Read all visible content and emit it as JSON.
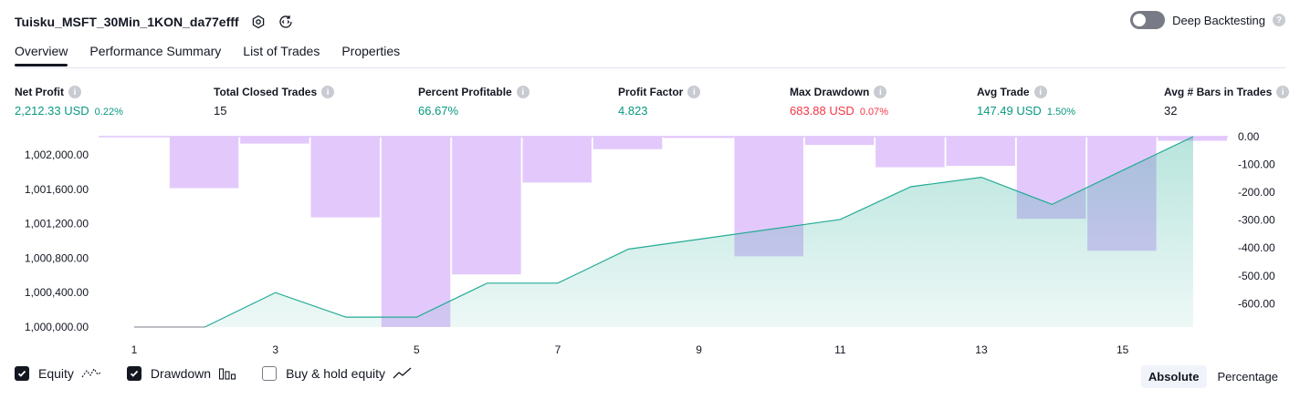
{
  "header": {
    "title": "Tuisku_MSFT_30Min_1KON_da77efff",
    "deep_backtesting_label": "Deep Backtesting",
    "help_glyph": "?"
  },
  "tabs": [
    {
      "label": "Overview",
      "active": true
    },
    {
      "label": "Performance Summary",
      "active": false
    },
    {
      "label": "List of Trades",
      "active": false
    },
    {
      "label": "Properties",
      "active": false
    }
  ],
  "stats": {
    "net_profit": {
      "label": "Net Profit",
      "value": "2,212.33 USD",
      "pct": "0.22%"
    },
    "total_closed_trades": {
      "label": "Total Closed Trades",
      "value": "15"
    },
    "percent_profitable": {
      "label": "Percent Profitable",
      "value": "66.67%"
    },
    "profit_factor": {
      "label": "Profit Factor",
      "value": "4.823"
    },
    "max_drawdown": {
      "label": "Max Drawdown",
      "value": "683.88 USD",
      "pct": "0.07%"
    },
    "avg_trade": {
      "label": "Avg Trade",
      "value": "147.49 USD",
      "pct": "1.50%"
    },
    "avg_bars": {
      "label": "Avg # Bars in Trades",
      "value": "32"
    }
  },
  "chart_data": {
    "type": "line",
    "x": [
      1,
      2,
      3,
      4,
      5,
      6,
      7,
      8,
      9,
      10,
      11,
      12,
      13,
      14,
      15,
      16
    ],
    "x_ticks": [
      "1",
      "3",
      "5",
      "7",
      "9",
      "11",
      "13",
      "15"
    ],
    "series": [
      {
        "name": "Equity",
        "type": "area",
        "axis": "left",
        "color": "#22ab94",
        "values": [
          1000000,
          1000000,
          1000400,
          1000115,
          1000115,
          1000510,
          1000510,
          1000905,
          1001020,
          1001135,
          1001250,
          1001630,
          1001740,
          1001425,
          1001820,
          1002212.33
        ]
      },
      {
        "name": "Drawdown",
        "type": "bar",
        "axis": "right",
        "color": "#e1c4fb",
        "values": [
          0,
          -185,
          -25,
          -290,
          -684,
          -495,
          -165,
          -45,
          -5,
          -430,
          -30,
          -110,
          -105,
          -295,
          -410,
          -15
        ]
      }
    ],
    "left_axis": {
      "ticks": [
        "1,000,000.00",
        "1,000,400.00",
        "1,000,800.00",
        "1,001,200.00",
        "1,001,600.00",
        "1,002,000.00"
      ],
      "ylim": [
        1000000,
        1002212.33
      ]
    },
    "right_axis": {
      "ticks": [
        "0.00",
        "-100.00",
        "-200.00",
        "-300.00",
        "-400.00",
        "-500.00",
        "-600.00"
      ],
      "ylim": [
        -684,
        0
      ]
    }
  },
  "legend": {
    "equity": {
      "label": "Equity",
      "checked": true
    },
    "drawdown": {
      "label": "Drawdown",
      "checked": true
    },
    "buy_hold": {
      "label": "Buy & hold equity",
      "checked": false
    }
  },
  "modes": {
    "absolute": "Absolute",
    "percentage": "Percentage",
    "active": "Absolute"
  },
  "colors": {
    "green": "#089981",
    "red": "#f23645",
    "equity_line": "#22ab94",
    "drawdown_bar": "#e1c4fb"
  }
}
